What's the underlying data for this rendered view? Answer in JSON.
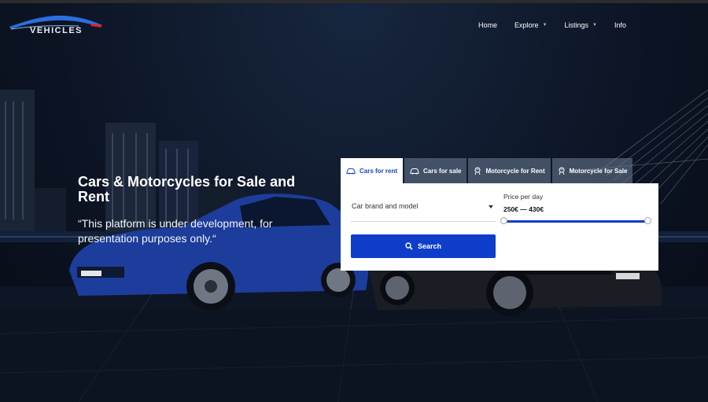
{
  "header": {
    "logo_text": "VEHICLES",
    "nav": [
      {
        "label": "Home",
        "has_dropdown": false
      },
      {
        "label": "Explore",
        "has_dropdown": true
      },
      {
        "label": "Listings",
        "has_dropdown": true
      },
      {
        "label": "Info",
        "has_dropdown": false
      }
    ]
  },
  "hero": {
    "title": "Cars & Motorcycles for Sale and Rent",
    "subtitle": "“This platform is under development, for presentation purposes only.“"
  },
  "search": {
    "tabs": [
      {
        "label": "Cars for rent",
        "icon": "car-icon",
        "active": true
      },
      {
        "label": "Cars for sale",
        "icon": "car-icon",
        "active": false
      },
      {
        "label": "Motorcycle for Rent",
        "icon": "motorcycle-icon",
        "active": false
      },
      {
        "label": "Motorcycle for Sale",
        "icon": "motorcycle-icon",
        "active": false
      }
    ],
    "brand_select": {
      "placeholder": "Car brand and model"
    },
    "price": {
      "label": "Price per day",
      "range_text": "250€ — 430€"
    },
    "button_label": "Search"
  },
  "colors": {
    "accent": "#0e3ec9",
    "tab_active_text": "#1642c8",
    "background": "#0d1626"
  }
}
